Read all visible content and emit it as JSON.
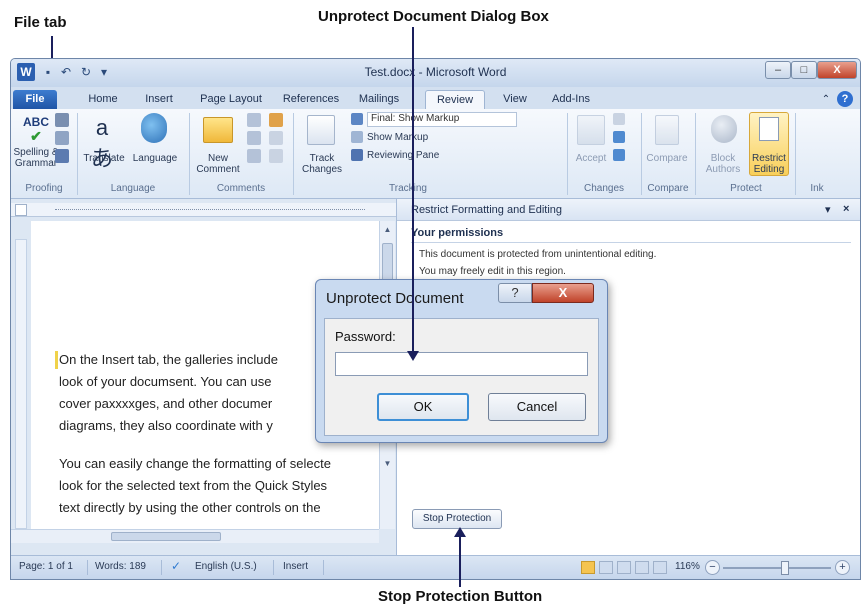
{
  "annotations": {
    "file_tab": "File tab",
    "dialog_box": "Unprotect Document Dialog Box",
    "stop_button": "Stop Protection Button"
  },
  "window": {
    "title": "Test.docx - Microsoft Word",
    "minimize": "–",
    "maximize": "□",
    "close": "X"
  },
  "ribbon": {
    "tabs": [
      "File",
      "Home",
      "Insert",
      "Page Layout",
      "References",
      "Mailings",
      "Review",
      "View",
      "Add-Ins"
    ],
    "active_tab": "Review",
    "groups": {
      "proofing": {
        "label": "Proofing",
        "spelling": "Spelling & Grammar"
      },
      "language": {
        "label": "Language",
        "translate": "Translate",
        "language": "Language"
      },
      "comments": {
        "label": "Comments",
        "new_comment": "New Comment"
      },
      "tracking": {
        "label": "Tracking",
        "track_changes": "Track Changes",
        "final_show_markup": "Final: Show Markup",
        "show_markup": "Show Markup",
        "reviewing_pane": "Reviewing Pane"
      },
      "changes": {
        "label": "Changes",
        "accept": "Accept"
      },
      "compare": {
        "label": "Compare",
        "compare": "Compare"
      },
      "protect": {
        "label": "Protect",
        "block_authors": "Block Authors",
        "restrict_editing": "Restrict Editing"
      },
      "ink": {
        "label": "Ink"
      }
    }
  },
  "document": {
    "paragraph1": [
      "On the Insert tab, the galleries include",
      "look of your documsent. You can use",
      "cover paxxxxges, and other documer",
      "diagrams, they also coordinate with y"
    ],
    "paragraph2": [
      "You can easily change the formatting of selecte",
      "look for the selected text from the Quick Styles",
      "text directly by using the other controls on the"
    ]
  },
  "task_pane": {
    "title": "Restrict Formatting and Editing",
    "section": "Your permissions",
    "line1": "This document is protected from unintentional editing.",
    "line2": "You may freely edit in this region.",
    "stop_protection": "Stop Protection"
  },
  "dialog": {
    "title": "Unprotect Document",
    "help": "?",
    "close": "X",
    "password_label": "Password:",
    "password_value": "",
    "ok": "OK",
    "cancel": "Cancel"
  },
  "status_bar": {
    "page": "Page: 1 of 1",
    "words": "Words: 189",
    "language": "English (U.S.)",
    "mode": "Insert",
    "zoom": "116%"
  },
  "colors": {
    "arrow": "#1a1f5c",
    "file_tab": "#2a63b6",
    "close_button": "#c0432a"
  }
}
